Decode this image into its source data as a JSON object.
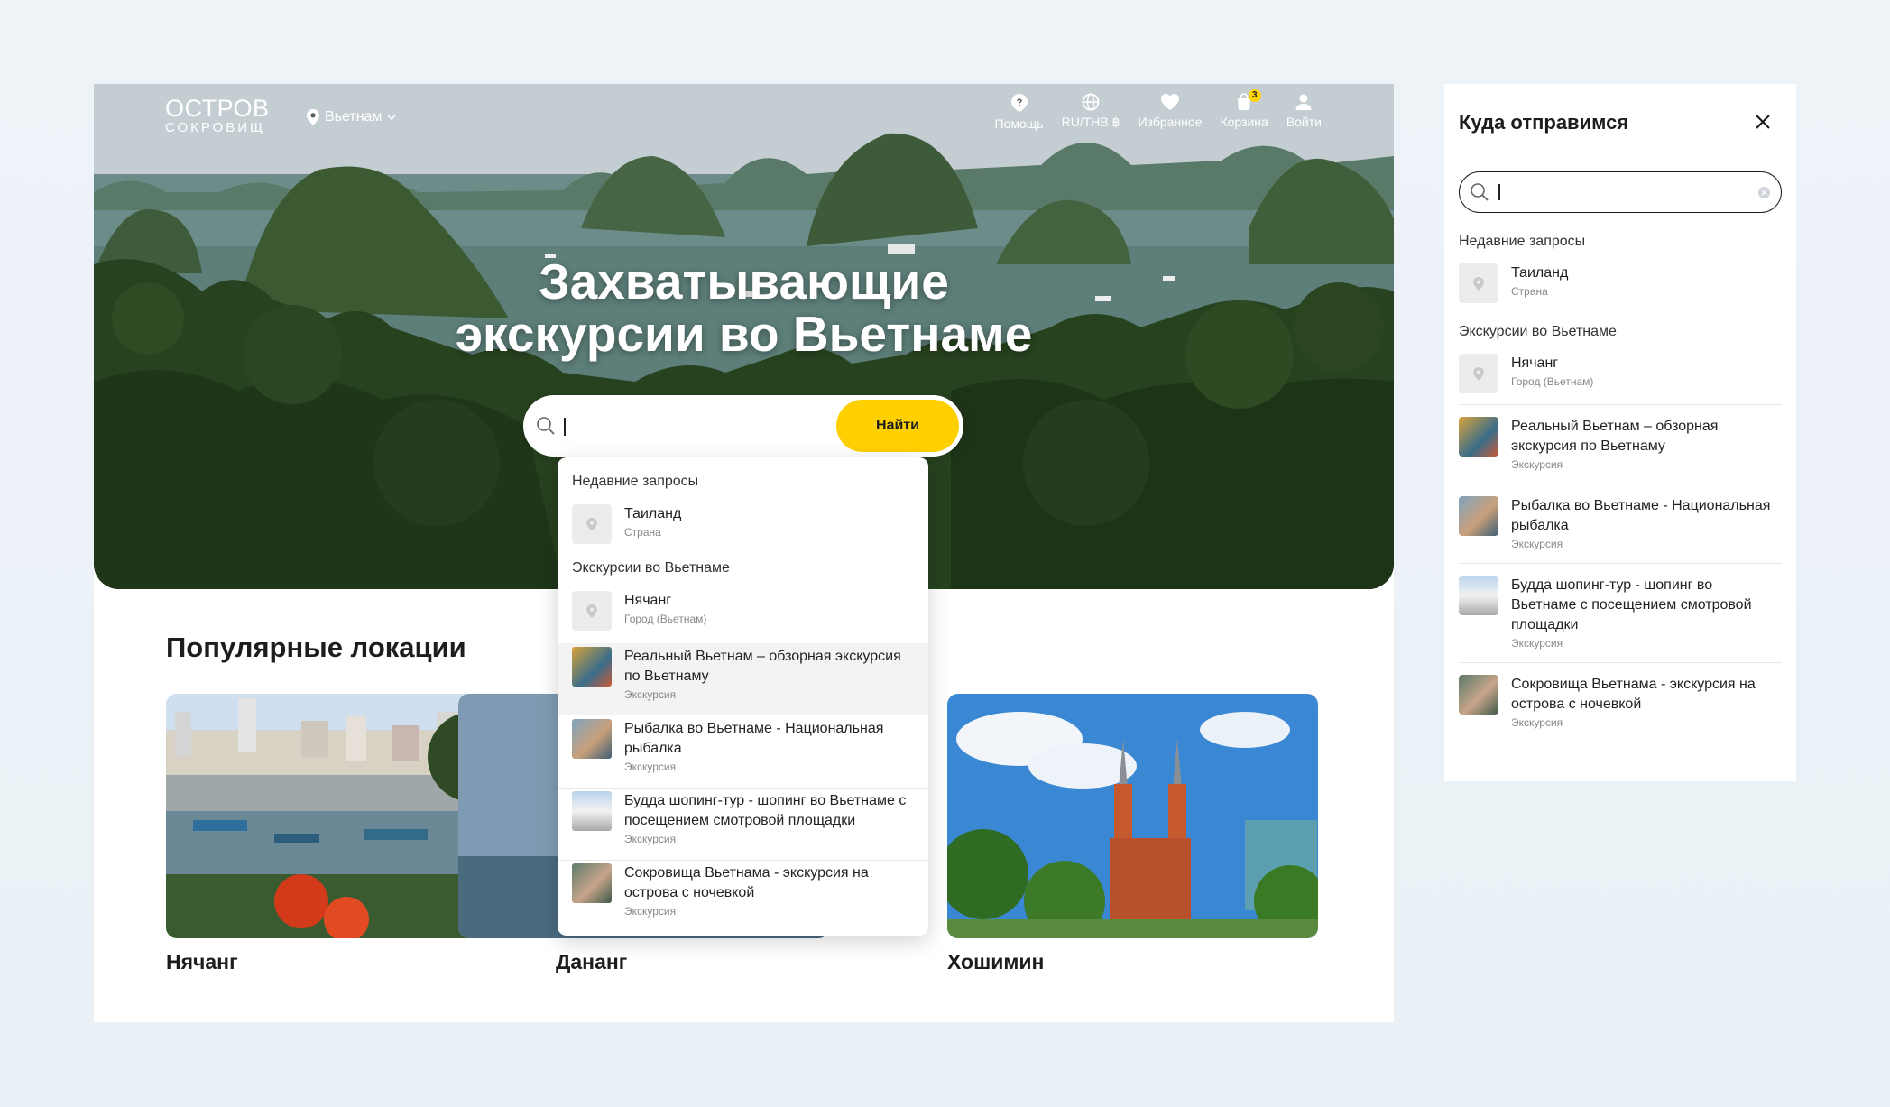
{
  "header": {
    "logo_line1": "ОСТРОВ",
    "logo_line2": "СОКРОВИЩ",
    "location": "Вьетнам",
    "nav": {
      "help": "Помощь",
      "currency": "RU/THB ฿",
      "favorites": "Избранное",
      "cart": "Корзина",
      "cart_count": "3",
      "login": "Войти"
    }
  },
  "hero": {
    "title_line1": "Захватывающие",
    "title_line2": "экскурсии во Вьетнаме"
  },
  "search": {
    "button": "Найти",
    "recent_header": "Недавние запросы",
    "tours_header": "Экскурсии во Вьетнаме",
    "recent": [
      {
        "title": "Таиланд",
        "sub": "Страна"
      }
    ],
    "results": [
      {
        "title": "Нячанг",
        "sub": "Город (Вьетнам)",
        "type": "place"
      },
      {
        "title": "Реальный Вьетнам – обзорная экскурсия по Вьетнаму",
        "sub": "Экскурсия",
        "type": "tour"
      },
      {
        "title": "Рыбалка во Вьетнаме - Национальная рыбалка",
        "sub": "Экскурсия",
        "type": "tour"
      },
      {
        "title": "Будда шопинг-тур - шопинг во Вьетнаме с посещением смотровой площадки",
        "sub": "Экскурсия",
        "type": "tour"
      },
      {
        "title": "Сокровища Вьетнама - экскурсия на острова с ночевкой",
        "sub": "Экскурсия",
        "type": "tour"
      }
    ]
  },
  "popular": {
    "heading": "Популярные локации",
    "cities": [
      "Нячанг",
      "Дананг",
      "Хошимин"
    ]
  },
  "panel": {
    "title": "Куда отправимся",
    "recent_header": "Недавние запросы",
    "tours_header": "Экскурсии во Вьетнаме"
  },
  "colors": {
    "accent": "#ffd000",
    "text": "#1d1d1f"
  }
}
